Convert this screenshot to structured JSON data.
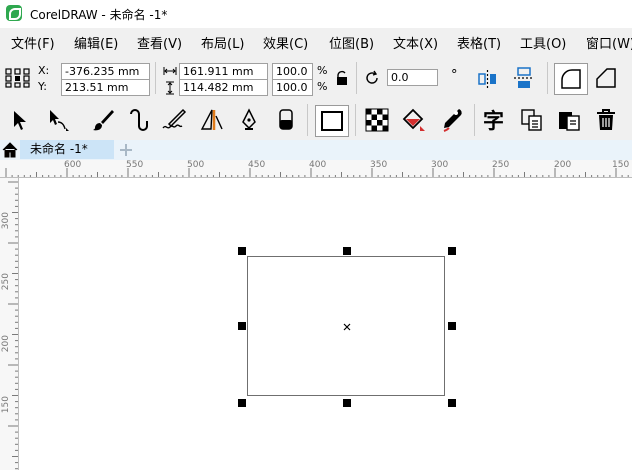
{
  "window": {
    "title": "CorelDRAW - 未命名 -1*"
  },
  "menu": [
    "文件(F)",
    "编辑(E)",
    "查看(V)",
    "布局(L)",
    "效果(C)",
    "位图(B)",
    "文本(X)",
    "表格(T)",
    "工具(O)",
    "窗口(W)"
  ],
  "properties": {
    "x_label": "X:",
    "x_value": "-376.235 mm",
    "y_label": "Y:",
    "y_value": "213.51 mm",
    "width_value": "161.911 mm",
    "height_value": "114.482 mm",
    "scale_x": "100.0",
    "scale_y": "100.0",
    "percent": "%",
    "rotation": "0.0",
    "degree": "°"
  },
  "tab": {
    "label": "未命名 -1*"
  },
  "ruler": {
    "h_ticks": [
      "600",
      "550",
      "500",
      "450",
      "400",
      "350",
      "300",
      "250",
      "200",
      "150"
    ],
    "v_ticks": [
      "300",
      "250",
      "200",
      "150"
    ]
  },
  "colors": {
    "accent": "#1a73c8",
    "orange": "#e07b1a",
    "red": "#d32f2f",
    "tab_active": "#cce4f7"
  }
}
